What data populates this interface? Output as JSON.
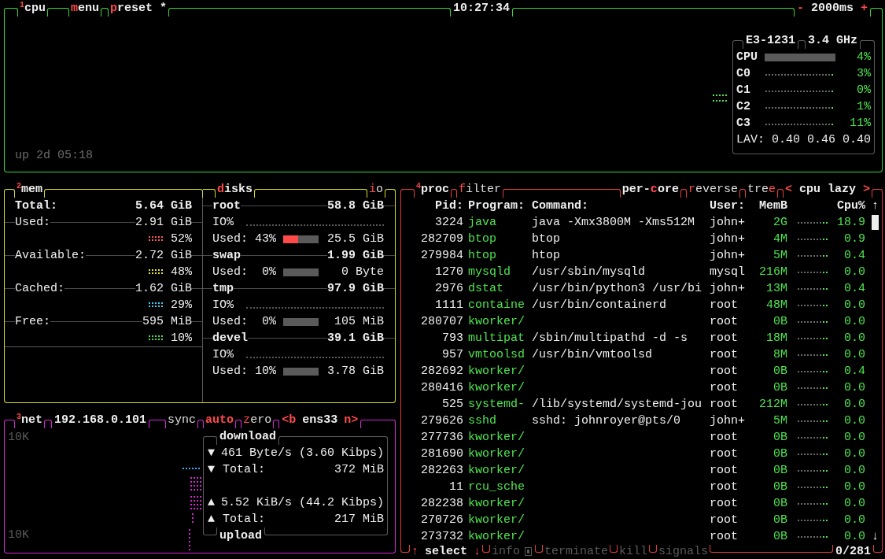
{
  "cpu_panel": {
    "title": "$^{1}$cpu",
    "buttons": [
      {
        "key": "m",
        "after": "enu"
      },
      {
        "key": "p",
        "after": "reset *"
      }
    ],
    "clock": "10:27:34",
    "interval": {
      "minus": "-",
      "value": "2000ms",
      "plus": "+"
    },
    "uptime": "up 2d 05:18",
    "cpu_box": {
      "model": "E3-1231",
      "freq": "3.4 GHz",
      "rows": [
        {
          "kind": "bar",
          "label": "CPU",
          "percent": "4%"
        },
        {
          "kind": "graph",
          "label": "C0",
          "percent": "3%"
        },
        {
          "kind": "graph",
          "label": "C1",
          "percent": "0%"
        },
        {
          "kind": "graph",
          "label": "C2",
          "percent": "1%"
        },
        {
          "kind": "graph",
          "label": "C3",
          "percent": "11%"
        }
      ],
      "load": "LAV: 0.40 0.46 0.40"
    }
  },
  "mem_panel": {
    "title": "$^{2}$mem",
    "rows": [
      {
        "kind": "total",
        "label": "Total:",
        "value": "5.64 GiB"
      },
      {
        "kind": "meter",
        "label": "Used:",
        "value": "2.91 GiB",
        "percent": "52%",
        "color": "#ff5555"
      },
      {
        "kind": "meter",
        "label": "Available:",
        "value": "2.72 GiB",
        "percent": "48%",
        "color": "#e0e040"
      },
      {
        "kind": "meter",
        "label": "Cached:",
        "value": "1.62 GiB",
        "percent": "29%",
        "color": "#40c8f0"
      },
      {
        "kind": "meter",
        "label": "Free:",
        "value": "595 MiB",
        "percent": "10%",
        "color": "#50e050"
      }
    ]
  },
  "disks_panel": {
    "title": {
      "key": "d",
      "after": "isks"
    },
    "io_button": {
      "key": "i",
      "after": "o"
    },
    "disks": [
      {
        "name": "root",
        "size": "58.8 GiB",
        "io": "IO%",
        "used_label": "Used:",
        "used_percent": "43%",
        "level": 0.43,
        "amount": "25.5 GiB"
      },
      {
        "name": "swap",
        "size": "1.99 GiB",
        "used_label": "Used:",
        "used_percent": "0%",
        "amount": "0 Byte"
      },
      {
        "name": "tmp",
        "size": "97.9 GiB",
        "io": "IO%",
        "used_label": "Used:",
        "used_percent": "0%",
        "amount": "105 MiB"
      },
      {
        "name": "devel",
        "size": "39.1 GiB",
        "io": "IO%",
        "used_label": "Used:",
        "used_percent": "10%",
        "amount": "3.78 GiB"
      }
    ]
  },
  "net_panel": {
    "title": "$^{3}$net",
    "ip": "192.168.0.101",
    "toggles": [
      {
        "before": "sync",
        "on": false
      },
      {
        "key": "a",
        "after": "uto",
        "on": true
      },
      {
        "key": "z",
        "after": "ero",
        "on": false
      }
    ],
    "iface": {
      "prev": "<b",
      "name": "ens33",
      "next": "n>"
    },
    "scale_top": "10K",
    "scale_bottom": "10K",
    "download": {
      "title": "download",
      "rows": [
        {
          "kind": "rate",
          "arrow": "▼",
          "text": "461 Byte/s (3.60 Kibps)"
        },
        {
          "kind": "total",
          "arrow": "▼",
          "label": "Total:",
          "value": "372 MiB"
        }
      ]
    },
    "upload": {
      "title": "upload",
      "rows": [
        {
          "kind": "rate",
          "arrow": "▲",
          "text": "5.52 KiB/s (44.2 Kibps)"
        },
        {
          "kind": "total",
          "arrow": "▲",
          "label": "Total:",
          "value": "217 MiB"
        }
      ]
    }
  },
  "proc_panel": {
    "title": "$^{4}$proc",
    "filter": {
      "key": "f",
      "after": "ilter"
    },
    "options": [
      {
        "before": "per-",
        "key": "c",
        "after": "ore",
        "on": true
      },
      {
        "key": "r",
        "after": "everse",
        "on": false
      },
      {
        "before": "tre",
        "key": "e",
        "on": false
      }
    ],
    "sort": {
      "prev": "<",
      "label": "cpu lazy",
      "next": ">"
    },
    "columns": [
      "Pid:",
      "Program:",
      "Command:",
      "User:",
      "MemB",
      "Cpu%"
    ],
    "rows": [
      {
        "pid": "3224",
        "program": "java",
        "command": "java -Xmx3800M -Xms512M",
        "user": "john+",
        "mem": "2G",
        "cpu": "18.9"
      },
      {
        "pid": "282709",
        "program": "btop",
        "command": "btop",
        "user": "john+",
        "mem": "4M",
        "cpu": "0.9"
      },
      {
        "pid": "279984",
        "program": "htop",
        "command": "htop",
        "user": "john+",
        "mem": "5M",
        "cpu": "0.4"
      },
      {
        "pid": "1270",
        "program": "mysqld",
        "command": "/usr/sbin/mysqld",
        "user": "mysql",
        "mem": "216M",
        "cpu": "0.0"
      },
      {
        "pid": "2976",
        "program": "dstat",
        "command": "/usr/bin/python3 /usr/bi",
        "user": "john+",
        "mem": "13M",
        "cpu": "0.4"
      },
      {
        "pid": "1111",
        "program": "containe",
        "command": "/usr/bin/containerd",
        "user": "root",
        "mem": "48M",
        "cpu": "0.0"
      },
      {
        "pid": "280707",
        "program": "kworker/",
        "user": "root",
        "mem": "0B",
        "cpu": "0.0"
      },
      {
        "pid": "793",
        "program": "multipat",
        "command": "/sbin/multipathd -d -s",
        "user": "root",
        "mem": "18M",
        "cpu": "0.0"
      },
      {
        "pid": "957",
        "program": "vmtoolsd",
        "command": "/usr/bin/vmtoolsd",
        "user": "root",
        "mem": "8M",
        "cpu": "0.0"
      },
      {
        "pid": "282692",
        "program": "kworker/",
        "user": "root",
        "mem": "0B",
        "cpu": "0.4"
      },
      {
        "pid": "280416",
        "program": "kworker/",
        "user": "root",
        "mem": "0B",
        "cpu": "0.0"
      },
      {
        "pid": "525",
        "program": "systemd-",
        "command": "/lib/systemd/systemd-jou",
        "user": "root",
        "mem": "212M",
        "cpu": "0.0"
      },
      {
        "pid": "279626",
        "program": "sshd",
        "command": "sshd: johnroyer@pts/0",
        "user": "john+",
        "mem": "5M",
        "cpu": "0.0"
      },
      {
        "pid": "277736",
        "program": "kworker/",
        "user": "root",
        "mem": "0B",
        "cpu": "0.0"
      },
      {
        "pid": "281690",
        "program": "kworker/",
        "user": "root",
        "mem": "0B",
        "cpu": "0.0"
      },
      {
        "pid": "282263",
        "program": "kworker/",
        "user": "root",
        "mem": "0B",
        "cpu": "0.0"
      },
      {
        "pid": "11",
        "program": "rcu_sche",
        "user": "root",
        "mem": "0B",
        "cpu": "0.0"
      },
      {
        "pid": "282238",
        "program": "kworker/",
        "user": "root",
        "mem": "0B",
        "cpu": "0.0"
      },
      {
        "pid": "270726",
        "program": "kworker/",
        "user": "root",
        "mem": "0B",
        "cpu": "0.0"
      },
      {
        "pid": "273732",
        "program": "kworker/",
        "user": "root",
        "mem": "0B",
        "cpu": "0.0"
      }
    ],
    "scroll": {
      "up": "↑",
      "down": "↓"
    },
    "footer": {
      "up": "↑",
      "select": "select",
      "down": "↓",
      "actions": [
        {
          "label": "info",
          "disabled": true
        },
        {
          "label": "terminate",
          "disabled": true
        },
        {
          "label": "kill",
          "disabled": true
        },
        {
          "label": "signals",
          "disabled": true
        }
      ],
      "count": "0/281"
    }
  }
}
